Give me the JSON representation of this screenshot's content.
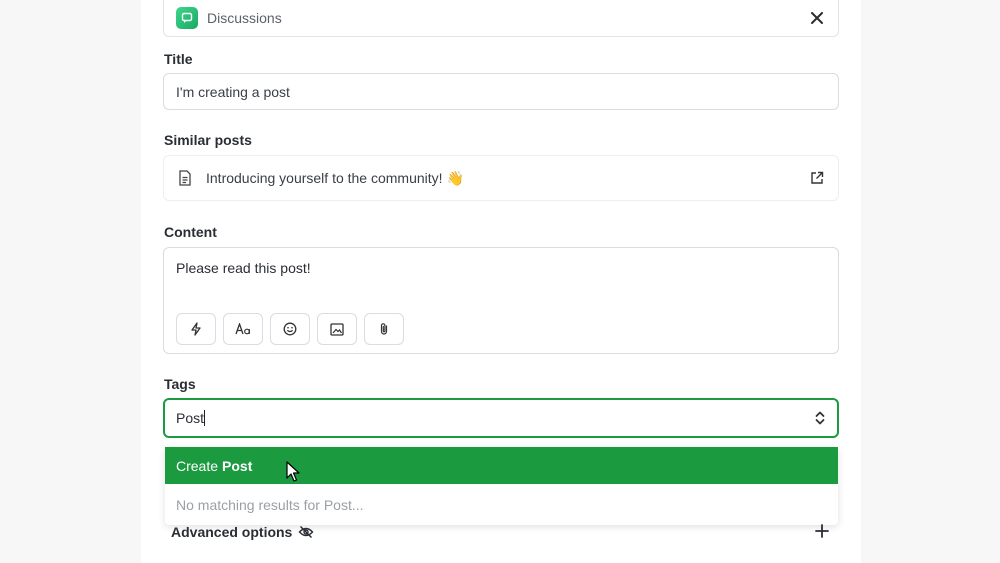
{
  "space": {
    "label": "Discussions"
  },
  "title_field": {
    "label": "Title",
    "value": "I'm creating a post"
  },
  "similar_posts": {
    "label": "Similar posts",
    "items": [
      {
        "title": "Introducing yourself to the community! 👋"
      }
    ]
  },
  "content_field": {
    "label": "Content",
    "value": "Please read this post!"
  },
  "toolbar": {
    "icons": [
      "lightning-icon",
      "text-format-icon",
      "emoji-icon",
      "image-icon",
      "attachment-icon"
    ]
  },
  "tags_field": {
    "label": "Tags",
    "value": "Post"
  },
  "dropdown": {
    "create_prefix": "Create",
    "create_value": "Post",
    "no_match": "No matching results for Post..."
  },
  "advanced": {
    "label": "Advanced options"
  },
  "colors": {
    "accent": "#1b9a3f",
    "border": "#d9dce0"
  }
}
